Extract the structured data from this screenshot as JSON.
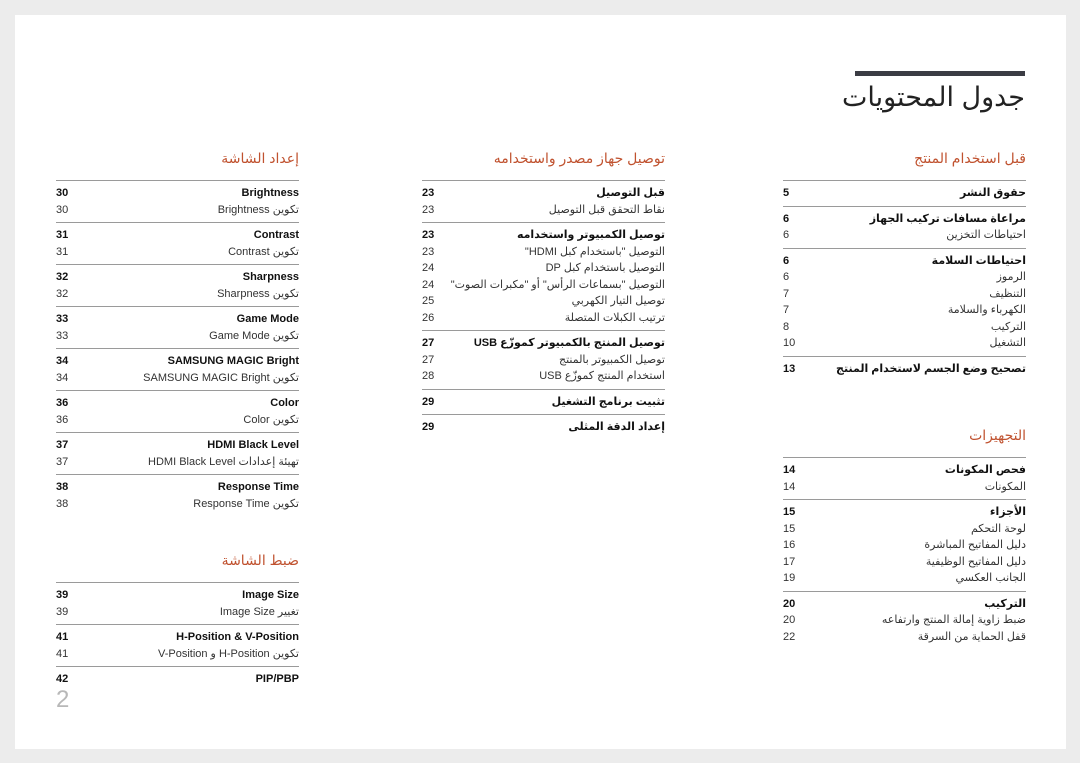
{
  "page": {
    "title": "جدول المحتويات",
    "page_number": "2",
    "accent_color": "#c0522f"
  },
  "columns": [
    {
      "sections": [
        {
          "title": "قبل استخدام المنتج",
          "groups": [
            {
              "head": {
                "label": "حقوق النشر",
                "page": "5"
              },
              "items": []
            },
            {
              "head": {
                "label": "مراعاة مسافات تركيب الجهاز",
                "page": "6"
              },
              "items": [
                {
                  "label": "احتياطات التخزين",
                  "page": "6"
                }
              ]
            },
            {
              "head": {
                "label": "احتياطات السلامة",
                "page": "6"
              },
              "items": [
                {
                  "label": "الرموز",
                  "page": "6"
                },
                {
                  "label": "التنظيف",
                  "page": "7"
                },
                {
                  "label": "الكهرباء والسلامة",
                  "page": "7"
                },
                {
                  "label": "التركيب",
                  "page": "8"
                },
                {
                  "label": "التشغيل",
                  "page": "10"
                }
              ]
            },
            {
              "head": {
                "label": "تصحيح وضع الجسم لاستخدام المنتج",
                "page": "13"
              },
              "items": []
            }
          ]
        },
        {
          "title": "التجهيزات",
          "groups": [
            {
              "head": {
                "label": "فحص المكونات",
                "page": "14"
              },
              "items": [
                {
                  "label": "المكونات",
                  "page": "14"
                }
              ]
            },
            {
              "head": {
                "label": "الأجزاء",
                "page": "15"
              },
              "items": [
                {
                  "label": "لوحة التحكم",
                  "page": "15"
                },
                {
                  "label": "دليل المفاتيح المباشرة",
                  "page": "16"
                },
                {
                  "label": "دليل المفاتيح الوظيفية",
                  "page": "17"
                },
                {
                  "label": "الجانب العكسي",
                  "page": "19"
                }
              ]
            },
            {
              "head": {
                "label": "التركيب",
                "page": "20"
              },
              "items": [
                {
                  "label": "ضبط زاوية إمالة المنتج وارتفاعه",
                  "page": "20"
                },
                {
                  "label": "قفل الحماية من السرقة",
                  "page": "22"
                }
              ]
            }
          ]
        }
      ]
    },
    {
      "sections": [
        {
          "title": "توصيل جهاز مصدر واستخدامه",
          "groups": [
            {
              "head": {
                "label": "قبل التوصيل",
                "page": "23"
              },
              "items": [
                {
                  "label": "نقاط التحقق قبل التوصيل",
                  "page": "23"
                }
              ]
            },
            {
              "head": {
                "label": "توصيل الكمبيوتر واستخدامه",
                "page": "23"
              },
              "items": [
                {
                  "label": "التوصيل \"باستخدام كبل HDMI\"",
                  "page": "23"
                },
                {
                  "label": "التوصيل باستخدام كبل DP",
                  "page": "24"
                },
                {
                  "label": "التوصيل \"بسماعات الرأس\" أو \"مكبرات الصوت\"",
                  "page": "24"
                },
                {
                  "label": "توصيل التيار الكهربي",
                  "page": "25"
                },
                {
                  "label": "ترتيب الكبلات المتصلة",
                  "page": "26"
                }
              ]
            },
            {
              "head": {
                "label": "توصيل المنتج بالكمبيوتر كموزّع USB",
                "page": "27"
              },
              "items": [
                {
                  "label": "توصيل الكمبيوتر بالمنتج",
                  "page": "27"
                },
                {
                  "label": "استخدام المنتج كموزّع USB",
                  "page": "28"
                }
              ]
            },
            {
              "head": {
                "label": "تثبيت برنامج التشغيل",
                "page": "29"
              },
              "items": []
            },
            {
              "head": {
                "label": "إعداد الدقة المثلى",
                "page": "29"
              },
              "items": []
            }
          ]
        }
      ]
    },
    {
      "sections": [
        {
          "title": "إعداد الشاشة",
          "groups": [
            {
              "head": {
                "label": "Brightness",
                "page": "30"
              },
              "items": [
                {
                  "label": "تكوين Brightness",
                  "page": "30"
                }
              ]
            },
            {
              "head": {
                "label": "Contrast",
                "page": "31"
              },
              "items": [
                {
                  "label": "تكوين Contrast",
                  "page": "31"
                }
              ]
            },
            {
              "head": {
                "label": "Sharpness",
                "page": "32"
              },
              "items": [
                {
                  "label": "تكوين Sharpness",
                  "page": "32"
                }
              ]
            },
            {
              "head": {
                "label": "Game Mode",
                "page": "33"
              },
              "items": [
                {
                  "label": "تكوين Game Mode",
                  "page": "33"
                }
              ]
            },
            {
              "head": {
                "label": "SAMSUNG MAGIC Bright",
                "page": "34"
              },
              "items": [
                {
                  "label": "تكوين SAMSUNG MAGIC Bright",
                  "page": "34"
                }
              ]
            },
            {
              "head": {
                "label": "Color",
                "page": "36"
              },
              "items": [
                {
                  "label": "تكوين Color",
                  "page": "36"
                }
              ]
            },
            {
              "head": {
                "label": "HDMI Black Level",
                "page": "37"
              },
              "items": [
                {
                  "label": "تهيئة إعدادات HDMI Black Level",
                  "page": "37"
                }
              ]
            },
            {
              "head": {
                "label": "Response Time",
                "page": "38"
              },
              "items": [
                {
                  "label": "تكوين Response Time",
                  "page": "38"
                }
              ]
            }
          ]
        },
        {
          "title": "ضبط الشاشة",
          "groups": [
            {
              "head": {
                "label": "Image Size",
                "page": "39"
              },
              "items": [
                {
                  "label": "تغيير Image Size",
                  "page": "39"
                }
              ]
            },
            {
              "head": {
                "label": "H-Position & V-Position",
                "page": "41"
              },
              "items": [
                {
                  "label": "تكوين H-Position و V-Position",
                  "page": "41"
                }
              ]
            },
            {
              "head": {
                "label": "PIP/PBP",
                "page": "42"
              },
              "items": []
            }
          ]
        }
      ]
    }
  ]
}
